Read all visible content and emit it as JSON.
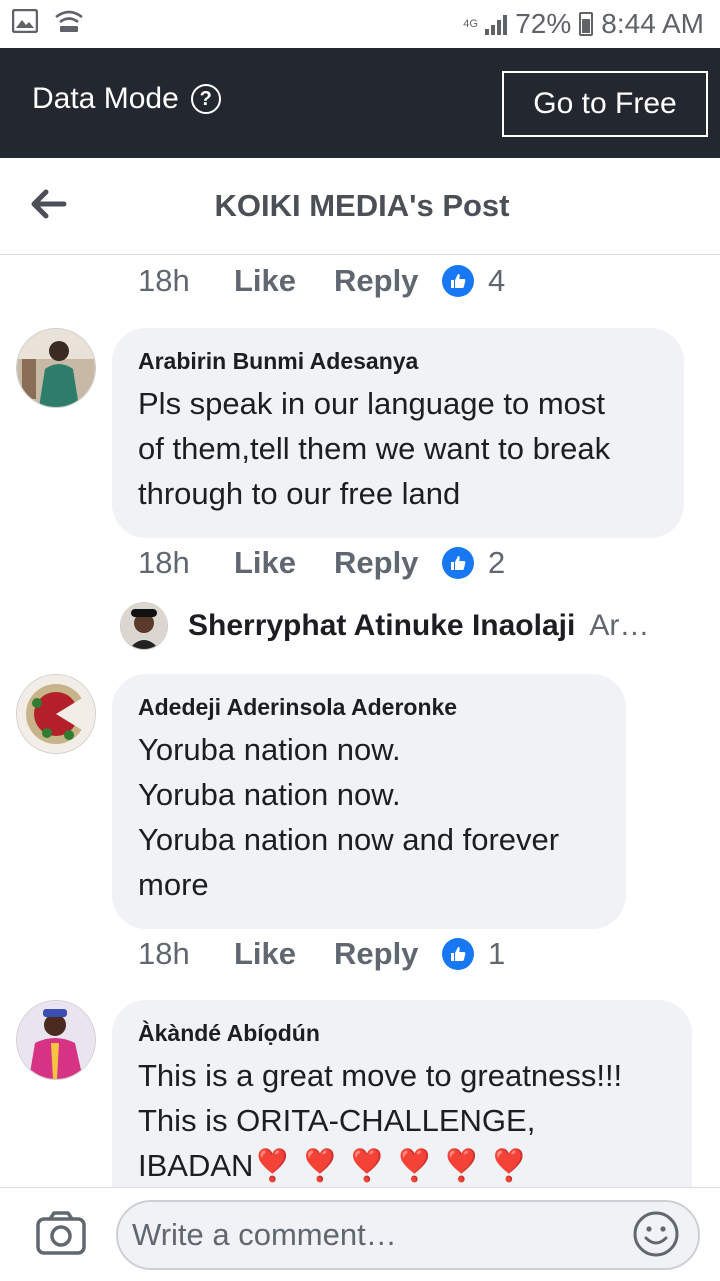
{
  "status_bar": {
    "network": "4G",
    "battery": "72%",
    "time": "8:44 AM"
  },
  "data_mode": {
    "title": "Data Mode",
    "button": "Go to Free"
  },
  "header": {
    "title": "KOIKI MEDIA's Post"
  },
  "comments": [
    {
      "actions": {
        "time": "18h",
        "like": "Like",
        "reply": "Reply",
        "likes": "4"
      }
    },
    {
      "author": "Arabirin Bunmi Adesanya",
      "text": "Pls speak in our language to most\nof them,tell them we want to break\nthrough to our free land",
      "actions": {
        "time": "18h",
        "like": "Like",
        "reply": "Reply",
        "likes": "2"
      },
      "reply_preview": {
        "name": "Sherryphat Atinuke Inaolaji",
        "snippet": "Ar…"
      }
    },
    {
      "author": "Adedeji Aderinsola Aderonke",
      "text": "Yoruba nation now.\nYoruba nation now.\nYoruba nation now and forever\nmore",
      "actions": {
        "time": "18h",
        "like": "Like",
        "reply": "Reply",
        "likes": "1"
      }
    },
    {
      "author": "Àkàndé Abíọdún",
      "text": "This is a great move to greatness!!!\nThis is ORITA-CHALLENGE,\nIBADAN❣️ ❣️ ❣️ ❣️ ❣️ ❣️"
    }
  ],
  "composer": {
    "placeholder": "Write a comment…"
  },
  "colors": {
    "accent": "#1877f2",
    "data_bar": "#23272f",
    "bubble": "#f0f2f5"
  }
}
